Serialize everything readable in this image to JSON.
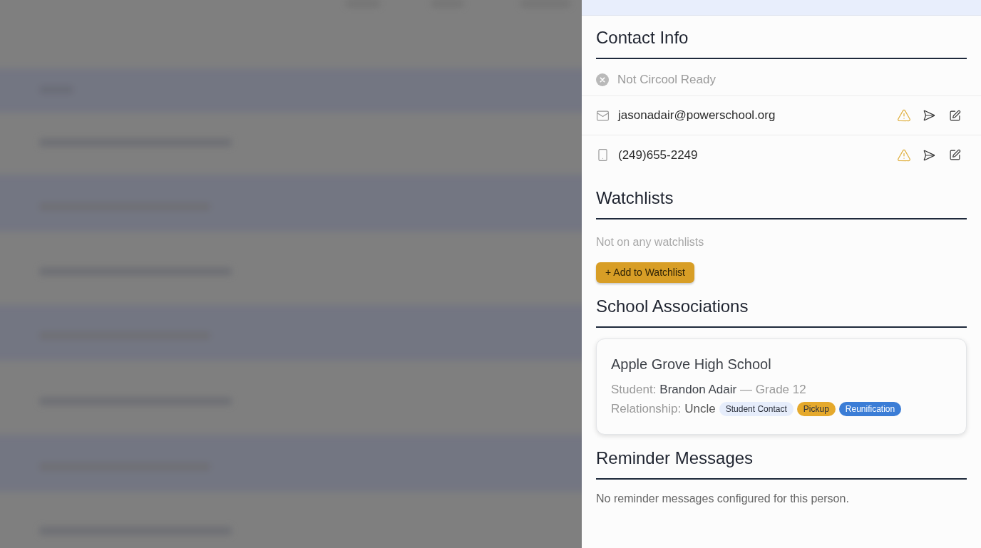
{
  "contact_info": {
    "title": "Contact Info",
    "status": {
      "label": "Not Circool Ready",
      "ready": false
    },
    "channels": [
      {
        "kind": "email",
        "value": "jasonadair@powerschool.org",
        "warning": true
      },
      {
        "kind": "phone",
        "value": "(249)655-2249",
        "warning": true
      }
    ]
  },
  "watchlists": {
    "title": "Watchlists",
    "empty_text": "Not on any watchlists",
    "add_button": "+ Add to Watchlist"
  },
  "school_associations": {
    "title": "School Associations",
    "schools": [
      {
        "name": "Apple Grove High School",
        "student_label": "Student:",
        "student_name": "Brandon Adair",
        "grade": "— Grade 12",
        "relationship_label": "Relationship:",
        "relationship": "Uncle",
        "tags": [
          {
            "label": "Student Contact",
            "color": "#e6edfb"
          },
          {
            "label": "Pickup",
            "color": "#e5a92c"
          },
          {
            "label": "Reunification",
            "color": "#3b7dd6"
          }
        ]
      }
    ]
  },
  "reminder_messages": {
    "title": "Reminder Messages",
    "empty_text": "No reminder messages configured for this person."
  }
}
